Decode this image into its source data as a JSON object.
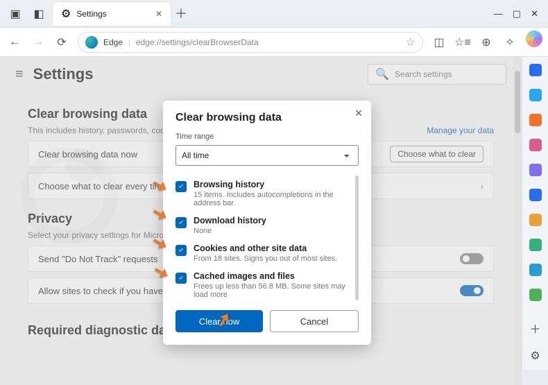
{
  "window": {
    "tab_title": "Settings",
    "vendor": "Edge",
    "url": "edge://settings/clearBrowserData"
  },
  "search": {
    "placeholder": "Search settings"
  },
  "settings_title": "Settings",
  "sections": {
    "clear": {
      "heading": "Clear browsing data",
      "desc": "This includes history, passwords, cookies, and more.",
      "link": "Manage your data",
      "row1": "Clear browsing data now",
      "row1_btn": "Choose what to clear",
      "row2": "Choose what to clear every time you close the browser"
    },
    "privacy": {
      "heading": "Privacy",
      "desc": "Select your privacy settings for Microsoft Edge.",
      "row1": "Send \"Do Not Track\" requests",
      "row2": "Allow sites to check if you have payment methods saved"
    },
    "diag": {
      "heading": "Required diagnostic data"
    }
  },
  "modal": {
    "title": "Clear browsing data",
    "range_label": "Time range",
    "range_value": "All time",
    "items": [
      {
        "title": "Browsing history",
        "sub": "15 items. Includes autocompletions in the address bar."
      },
      {
        "title": "Download history",
        "sub": "None"
      },
      {
        "title": "Cookies and other site data",
        "sub": "From 18 sites. Signs you out of most sites."
      },
      {
        "title": "Cached images and files",
        "sub": "Frees up less than 56.8 MB. Some sites may load more"
      }
    ],
    "clear_btn": "Clear now",
    "cancel_btn": "Cancel"
  },
  "rail_colors": [
    "#2a6cf0",
    "#2aa5f0",
    "#f0732a",
    "#d85c8c",
    "#7c6ff0",
    "#e8a23c",
    "#33b07c",
    "#2a9cd0",
    "#4fb058"
  ]
}
